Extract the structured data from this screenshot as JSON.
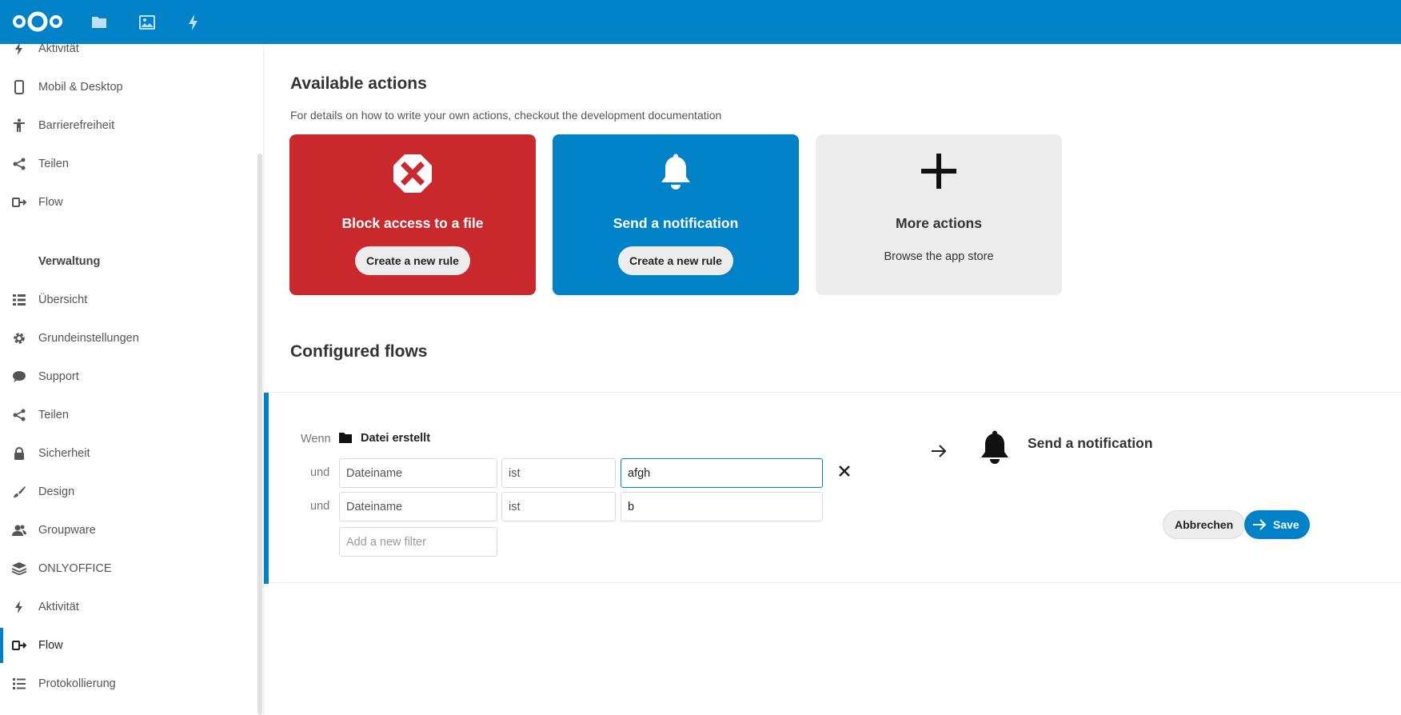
{
  "header": {
    "icons": [
      "nextcloud-logo",
      "files-icon",
      "photos-icon",
      "activity-icon"
    ],
    "brand_color": "#0082c9"
  },
  "sidebar": {
    "personal_items": [
      {
        "label": "Aktivität",
        "icon": "flash-icon"
      },
      {
        "label": "Mobil & Desktop",
        "icon": "phone-icon"
      },
      {
        "label": "Barrierefreiheit",
        "icon": "accessibility-icon"
      },
      {
        "label": "Teilen",
        "icon": "share-icon"
      },
      {
        "label": "Flow",
        "icon": "flow-icon"
      }
    ],
    "admin_heading": "Verwaltung",
    "admin_items": [
      {
        "label": "Übersicht",
        "icon": "overview-icon"
      },
      {
        "label": "Grundeinstellungen",
        "icon": "gear-icon"
      },
      {
        "label": "Support",
        "icon": "support-icon"
      },
      {
        "label": "Teilen",
        "icon": "share-icon"
      },
      {
        "label": "Sicherheit",
        "icon": "lock-icon"
      },
      {
        "label": "Design",
        "icon": "brush-icon"
      },
      {
        "label": "Groupware",
        "icon": "groupware-icon"
      },
      {
        "label": "ONLYOFFICE",
        "icon": "layers-icon"
      },
      {
        "label": "Aktivität",
        "icon": "flash-icon"
      },
      {
        "label": "Flow",
        "icon": "flow-icon",
        "active": true
      },
      {
        "label": "Protokollierung",
        "icon": "log-icon"
      }
    ]
  },
  "available_actions": {
    "title": "Available actions",
    "description": "For details on how to write your own actions, checkout the development documentation",
    "cards": [
      {
        "title": "Block access to a file",
        "button": "Create a new rule",
        "color": "#c9282d"
      },
      {
        "title": "Send a notification",
        "button": "Create a new rule",
        "color": "#0082c9"
      },
      {
        "title": "More actions",
        "subtitle": "Browse the app store",
        "color": "#ededed"
      }
    ]
  },
  "configured_flows": {
    "title": "Configured flows",
    "when_label": "Wenn",
    "event": "Datei erstellt",
    "and_label": "und",
    "filters": [
      {
        "field": "Dateiname",
        "operator": "ist",
        "value": "afgh"
      },
      {
        "field": "Dateiname",
        "operator": "ist",
        "value": "b"
      }
    ],
    "add_filter_placeholder": "Add a new filter",
    "action_title": "Send a notification",
    "cancel_label": "Abbrechen",
    "save_label": "Save"
  }
}
